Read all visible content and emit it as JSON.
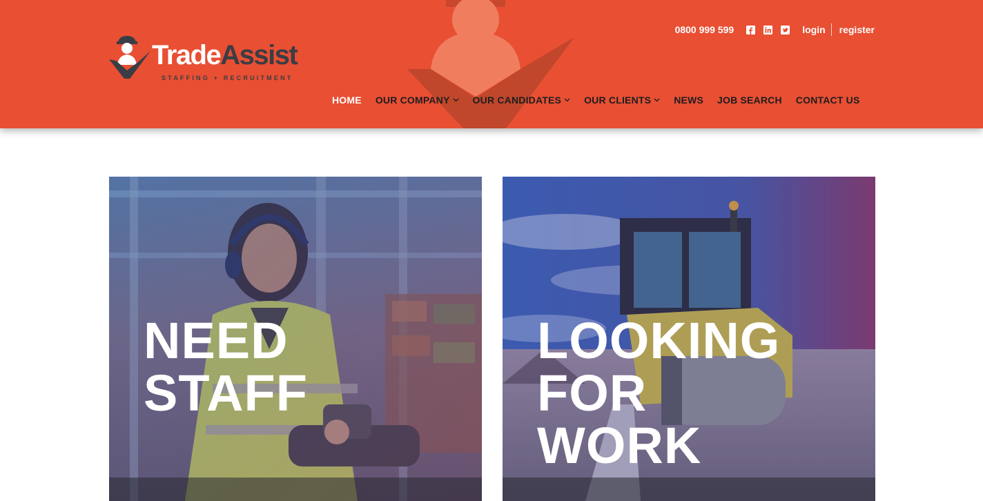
{
  "brand": {
    "name_part1": "Trade",
    "name_part2": "Assist",
    "tagline": "STAFFING + RECRUITMENT",
    "colors": {
      "primary": "#e84f33",
      "dark": "#3a3d44",
      "nav_text": "#1d1d1f"
    }
  },
  "topbar": {
    "phone": "0800 999 599",
    "social_icons": [
      "facebook-icon",
      "linkedin-icon",
      "twitter-icon"
    ],
    "login": "login",
    "register": "register"
  },
  "nav": {
    "items": [
      {
        "label": "HOME",
        "active": true,
        "dropdown": false
      },
      {
        "label": "OUR COMPANY",
        "active": false,
        "dropdown": true
      },
      {
        "label": "OUR CANDIDATES",
        "active": false,
        "dropdown": true
      },
      {
        "label": "OUR CLIENTS",
        "active": false,
        "dropdown": true
      },
      {
        "label": "NEWS",
        "active": false,
        "dropdown": false
      },
      {
        "label": "JOB SEARCH",
        "active": false,
        "dropdown": false
      },
      {
        "label": "CONTACT US",
        "active": false,
        "dropdown": false
      }
    ]
  },
  "cards": [
    {
      "line1": "NEED",
      "line2": "STAFF",
      "line3": "",
      "footer": ""
    },
    {
      "line1": "LOOKING",
      "line2": "FOR",
      "line3": "WORK",
      "footer": ""
    }
  ]
}
